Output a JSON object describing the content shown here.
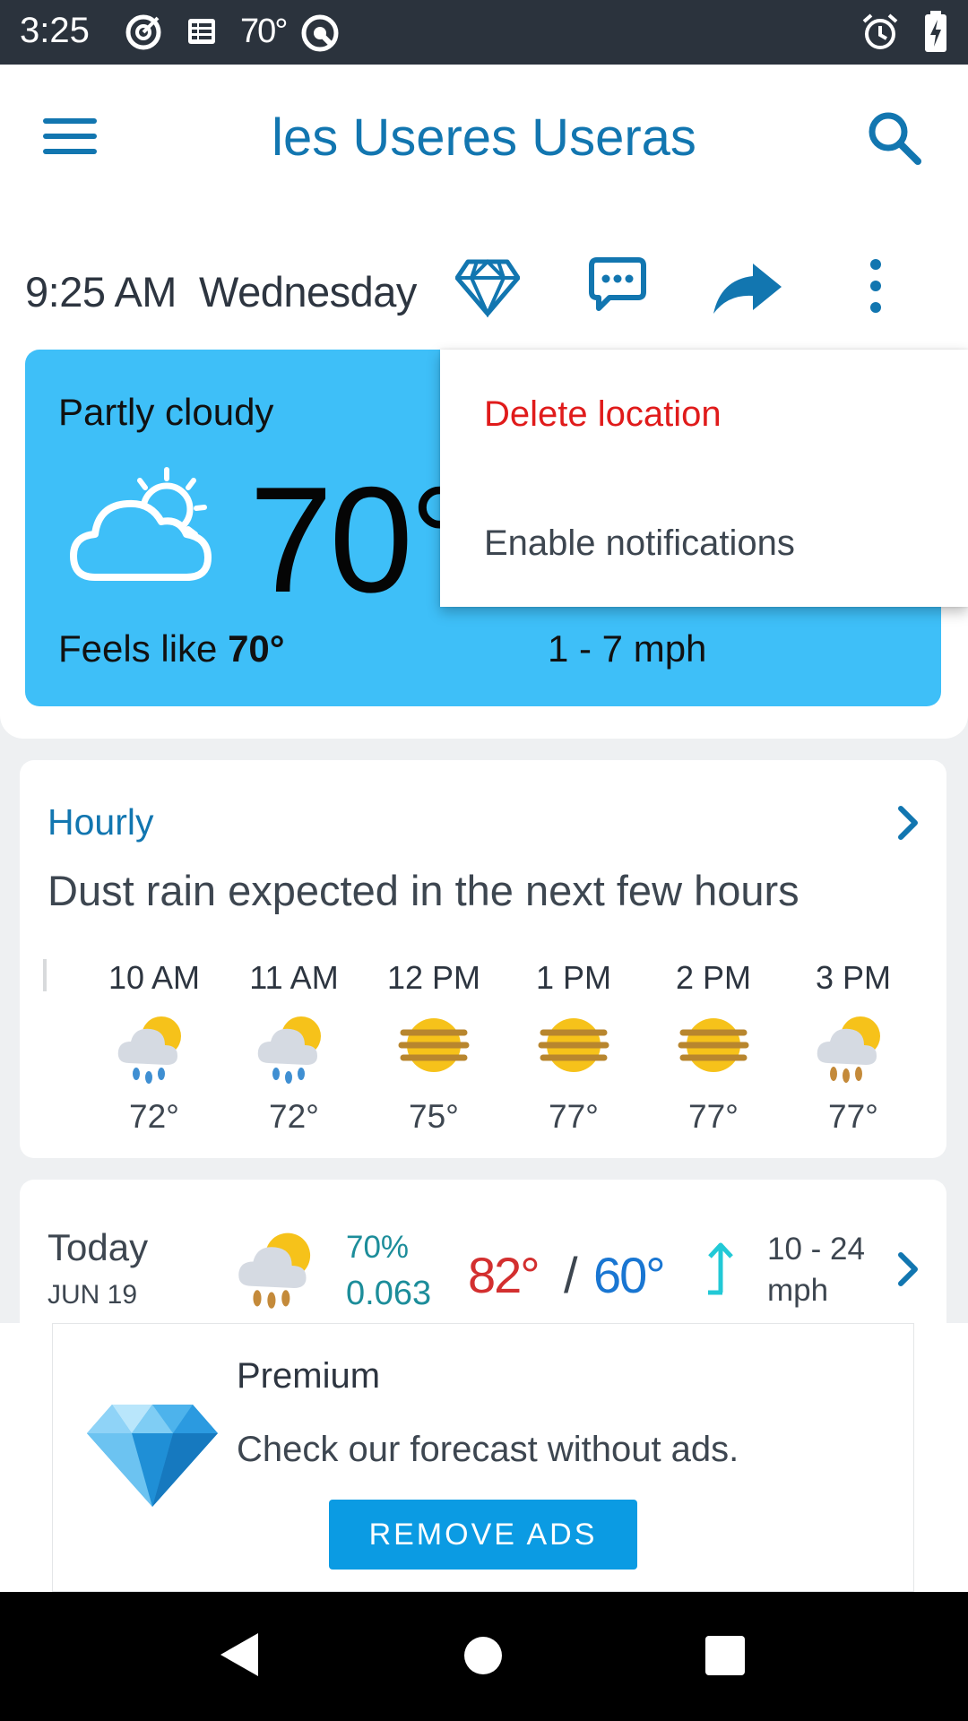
{
  "status_bar": {
    "time": "3:25",
    "temperature": "70°",
    "icons": [
      "target-icon",
      "news-icon",
      "at-icon",
      "alarm-icon",
      "battery-charging-icon"
    ]
  },
  "app_bar": {
    "title": "les Useres Useras",
    "icons": [
      "hamburger-menu-icon",
      "search-icon"
    ]
  },
  "date_row": {
    "datetime": "9:25 AM  Wednesday",
    "actions": [
      "diamond-icon",
      "chat-icon",
      "share-icon",
      "more-vertical-icon"
    ]
  },
  "current": {
    "condition": "Partly cloudy",
    "temperature": "70°",
    "feels_label": "Feels like ",
    "feels_value": "70°",
    "wind": "1 - 7 mph",
    "background": "#3ebff8"
  },
  "menu": {
    "items": [
      {
        "label": "Delete location",
        "color": "#e01b1b"
      },
      {
        "label": "Enable notifications",
        "color": "#3d4650"
      }
    ]
  },
  "hourly": {
    "title": "Hourly",
    "summary": "Dust rain expected in the next few hours",
    "items": [
      {
        "time": "10 AM",
        "icon": "sun-rain-icon",
        "temp": "72°"
      },
      {
        "time": "11 AM",
        "icon": "sun-rain-icon",
        "temp": "72°"
      },
      {
        "time": "12 PM",
        "icon": "haze-sun-icon",
        "temp": "75°"
      },
      {
        "time": "1 PM",
        "icon": "haze-sun-icon",
        "temp": "77°"
      },
      {
        "time": "2 PM",
        "icon": "haze-sun-icon",
        "temp": "77°"
      },
      {
        "time": "3 PM",
        "icon": "sun-dust-rain-icon",
        "temp": "77°"
      }
    ]
  },
  "daily": {
    "day": "Today",
    "date": "JUN 19",
    "precip_pct": "70%",
    "precip_amt": "0.063",
    "high": "82°",
    "separator": "/",
    "low": "60°",
    "wind_line1": "10 - 24",
    "wind_line2": "mph"
  },
  "ad": {
    "title": "Premium",
    "text": "Check our forecast without ads.",
    "button": "REMOVE ADS"
  },
  "colors": {
    "accent": "#1276b0",
    "high_temp": "#d32f2f",
    "low_temp": "#1976d2",
    "precip": "#1c8d9a",
    "button": "#0b9be3"
  }
}
